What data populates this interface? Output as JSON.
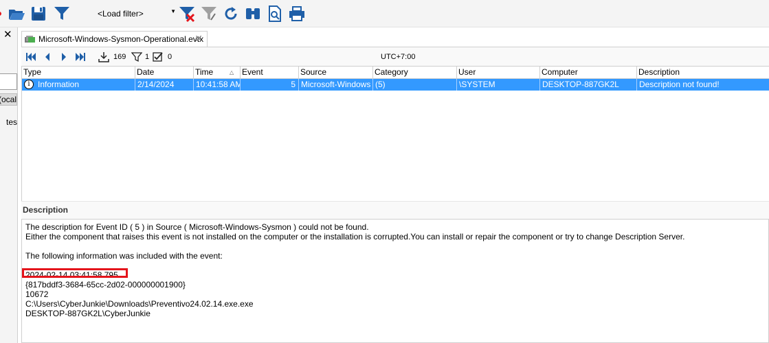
{
  "toolbar": {
    "load_filter_label": "<Load filter>",
    "icons": [
      "open-folder-icon",
      "save-icon",
      "filter-icon",
      "clear-filter-icon",
      "filter-settings-icon",
      "refresh-icon",
      "find-icon",
      "preview-icon",
      "print-icon"
    ]
  },
  "left_panel": {
    "close_label": "✕",
    "item1": "ocal)",
    "item2": "tes"
  },
  "tab": {
    "label": "Microsoft-Windows-Sysmon-Operational.evtx",
    "close": "✕"
  },
  "navbar": {
    "export_count": "169",
    "filter_count": "1",
    "checked_count": "0",
    "timezone": "UTC+7:00"
  },
  "grid": {
    "columns": [
      "Type",
      "Date",
      "Time",
      "Event",
      "Source",
      "Category",
      "User",
      "Computer",
      "Description"
    ],
    "rows": [
      {
        "type": "Information",
        "date": "2/14/2024",
        "time": "10:41:58 AM",
        "event": "5",
        "source": "Microsoft-Windows",
        "category": "(5)",
        "user": "\\SYSTEM",
        "computer": "DESKTOP-887GK2L",
        "description": "Description not found!"
      }
    ]
  },
  "description": {
    "header": "Description",
    "line1": "The description for Event ID ( 5 ) in Source ( Microsoft-Windows-Sysmon ) could not be found.",
    "line2": "Either the component that raises this event is not installed on the computer or the installation is corrupted.You can install or repair the component or try to change Description Server.",
    "line3": "The following information was included with the event:",
    "timestamp": "2024-02-14 03:41:58.795",
    "guid": "{817bddf3-3684-65cc-2d02-000000001900}",
    "pid": "10672",
    "image": "C:\\Users\\CyberJunkie\\Downloads\\Preventivo24.02.14.exe.exe",
    "user": "DESKTOP-887GK2L\\CyberJunkie"
  },
  "colors": {
    "selection": "#3399ff",
    "highlight_box": "#e4141b",
    "icon_blue": "#1f5fa8"
  }
}
